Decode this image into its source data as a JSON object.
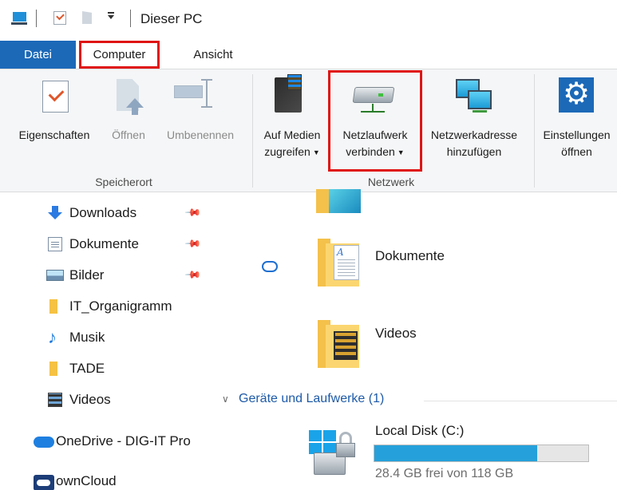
{
  "window": {
    "title": "Dieser PC"
  },
  "tabs": {
    "file": "Datei",
    "computer": "Computer",
    "view": "Ansicht"
  },
  "ribbon": {
    "groups": {
      "location": {
        "label": "Speicherort",
        "properties": "Eigenschaften",
        "open": "Öffnen",
        "rename": "Umbenennen"
      },
      "network": {
        "label": "Netzwerk",
        "media_line1": "Auf Medien",
        "media_line2": "zugreifen",
        "map_drive_line1": "Netzlaufwerk",
        "map_drive_line2": "verbinden",
        "add_location_line1": "Netzwerkadresse",
        "add_location_line2": "hinzufügen"
      },
      "system": {
        "settings_line1": "Einstellungen",
        "settings_line2": "öffnen"
      }
    }
  },
  "nav": {
    "items": [
      {
        "label": "Downloads"
      },
      {
        "label": "Dokumente"
      },
      {
        "label": "Bilder"
      },
      {
        "label": "IT_Organigramm"
      },
      {
        "label": "Musik"
      },
      {
        "label": "TADE"
      },
      {
        "label": "Videos"
      },
      {
        "label": "OneDrive - DIG-IT Pro"
      },
      {
        "label": "ownCloud"
      }
    ]
  },
  "content": {
    "folders": [
      {
        "label": "Dokumente"
      },
      {
        "label": "Videos"
      }
    ],
    "devices_section": "Geräte und Laufwerke (1)",
    "disk": {
      "label": "Local Disk (C:)",
      "free_text": "28.4 GB frei von 118 GB",
      "used_fraction": 0.76
    }
  },
  "colors": {
    "accent": "#1c69b8",
    "highlight": "#e01414",
    "disk_bar": "#26a0da"
  }
}
